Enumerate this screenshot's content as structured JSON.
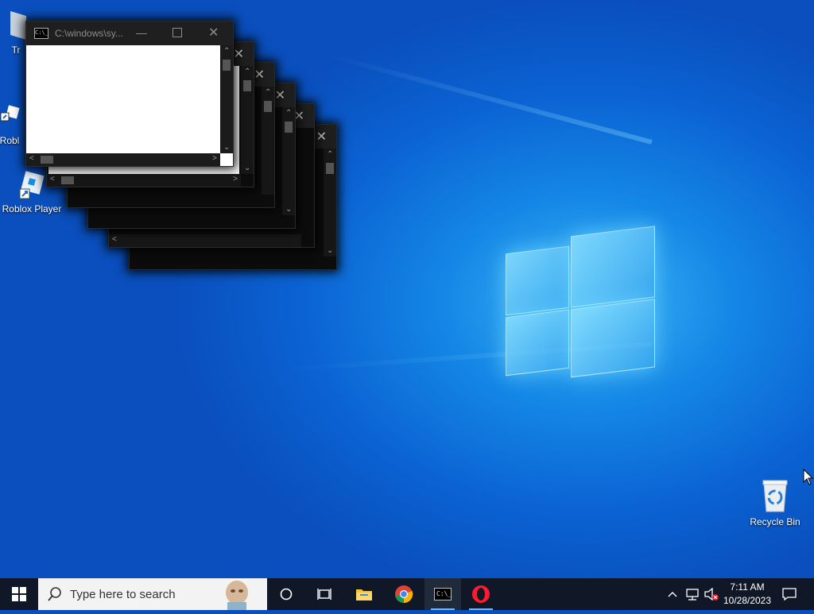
{
  "desktop": {
    "icons": [
      {
        "label": "Tr",
        "icon": "partial-icon"
      },
      {
        "label": "Robl",
        "icon": "roblox-shortcut-icon"
      },
      {
        "label": "Roblox Player",
        "icon": "roblox-player-icon"
      },
      {
        "label": "Recycle Bin",
        "icon": "recycle-bin-icon"
      }
    ]
  },
  "windows": {
    "front": {
      "title": "C:\\windows\\sy...",
      "icon": "cmd-icon"
    }
  },
  "taskbar": {
    "search_placeholder": "Type here to search",
    "pinned": [
      "start-icon",
      "cortana-icon",
      "task-view-icon",
      "file-explorer-icon",
      "chrome-icon",
      "cmd-icon",
      "opera-icon"
    ],
    "tray": {
      "time": "7:11 AM",
      "date": "10/28/2023"
    }
  },
  "colors": {
    "taskbar": "#101827",
    "desktop_accent": "#1487e6",
    "active_indicator": "#76b9ed"
  }
}
